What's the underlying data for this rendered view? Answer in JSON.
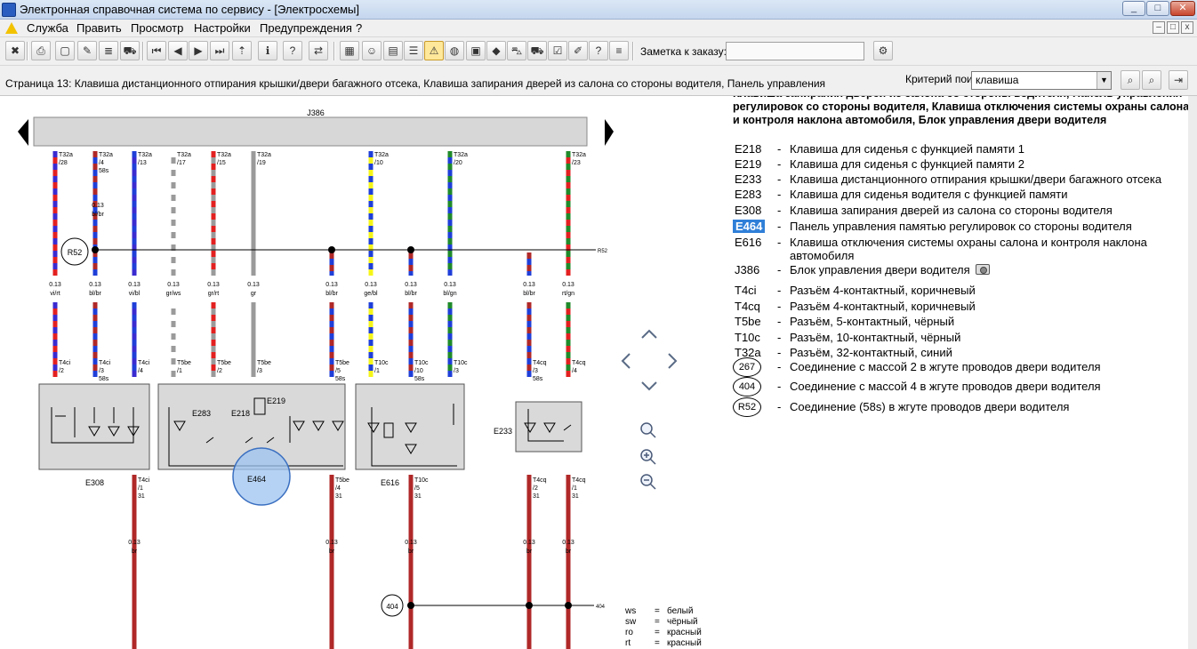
{
  "window": {
    "title": "Электронная справочная система по сервису - [Электросхемы]",
    "minimize_glyph": "_",
    "maximize_glyph": "□",
    "close_glyph": "✕"
  },
  "menu": {
    "items": [
      "Служба",
      "Править",
      "Просмотр",
      "Настройки",
      "Предупреждения",
      "?"
    ],
    "mdi_minimize": "–",
    "mdi_restore": "□",
    "mdi_close": "x"
  },
  "toolbar": {
    "order_label": "Заметка к заказу:",
    "order_value": ""
  },
  "status": {
    "page_caption": "Страница 13: Клавиша дистанционного отпирания крышки/двери багажного отсека, Клавиша запирания дверей из салона со стороны водителя, Панель управления",
    "criteria_label": "Критерий поиска:",
    "criteria_value": "клавиша"
  },
  "schematic": {
    "control_unit": "J386",
    "bus_label": "R52",
    "ground_label": "404",
    "top_pins": [
      {
        "conn": "T32a",
        "pin": "/28",
        "extra": "",
        "size": "0.13",
        "color": "vi/rt"
      },
      {
        "conn": "T32a",
        "pin": "/4",
        "extra": "58s",
        "size": "0.13",
        "color": "bl/br"
      },
      {
        "conn": "T32a",
        "pin": "/13",
        "extra": "",
        "size": "0.13",
        "color": "vi/bl"
      },
      {
        "conn": "T32a",
        "pin": "/17",
        "extra": "",
        "size": "0.13",
        "color": "gr/ws"
      },
      {
        "conn": "T32a",
        "pin": "/15",
        "extra": "",
        "size": "0.13",
        "color": "gr/rt"
      },
      {
        "conn": "T32a",
        "pin": "/19",
        "extra": "",
        "size": "0.13",
        "color": "gr"
      },
      {
        "conn": "",
        "pin": "",
        "extra": "",
        "size": "0.13",
        "color": "bl/br"
      },
      {
        "conn": "T32a",
        "pin": "/10",
        "extra": "",
        "size": "0.13",
        "color": "ge/bl"
      },
      {
        "conn": "",
        "pin": "",
        "extra": "",
        "size": "0.13",
        "color": "bl/br"
      },
      {
        "conn": "T32a",
        "pin": "/20",
        "extra": "",
        "size": "0.13",
        "color": "bl/gn"
      },
      {
        "conn": "",
        "pin": "",
        "extra": "",
        "size": "0.13",
        "color": "bl/br"
      },
      {
        "conn": "T32a",
        "pin": "/23",
        "extra": "",
        "size": "0.13",
        "color": "rt/gn"
      }
    ],
    "first_wire_size": "0.13",
    "first_wire_color": "bl/br",
    "mid_pins": [
      {
        "conn": "T4ci",
        "pin": "/2",
        "extra": ""
      },
      {
        "conn": "T4ci",
        "pin": "/3",
        "extra": "58s"
      },
      {
        "conn": "T4ci",
        "pin": "/4",
        "extra": ""
      },
      {
        "conn": "T5be",
        "pin": "/1",
        "extra": ""
      },
      {
        "conn": "T5be",
        "pin": "/2",
        "extra": ""
      },
      {
        "conn": "T5be",
        "pin": "/3",
        "extra": ""
      },
      {
        "conn": "T5be",
        "pin": "/5",
        "extra": "58s"
      },
      {
        "conn": "T10c",
        "pin": "/1",
        "extra": ""
      },
      {
        "conn": "T10c",
        "pin": "/10",
        "extra": "58s"
      },
      {
        "conn": "T10c",
        "pin": "/3",
        "extra": ""
      },
      {
        "conn": "T4cq",
        "pin": "/3",
        "extra": "58s"
      },
      {
        "conn": "T4cq",
        "pin": "/4",
        "extra": ""
      }
    ],
    "bottom_pins": [
      {
        "conn": "T4ci",
        "pin": "/1",
        "extra": "31"
      },
      {
        "conn": "T5be",
        "pin": "/4",
        "extra": "31"
      },
      {
        "conn": "T10c",
        "pin": "/5",
        "extra": "31"
      },
      {
        "conn": "T4cq",
        "pin": "/2",
        "extra": "31"
      },
      {
        "conn": "T4cq",
        "pin": "/1",
        "extra": "31"
      }
    ],
    "ground_wires": [
      {
        "size": "0.13",
        "color": "br"
      },
      {
        "size": "0.13",
        "color": "br"
      },
      {
        "size": "0.13",
        "color": "br"
      },
      {
        "size": "0.13",
        "color": "br"
      },
      {
        "size": "0.13",
        "color": "br"
      }
    ],
    "components": {
      "e308": "E308",
      "e283": "E283",
      "e218": "E218",
      "e219": "E219",
      "e464": "E464",
      "e616": "E616",
      "e233": "E233"
    },
    "color_key": [
      {
        "code": "ws",
        "eq": "=",
        "name": "белый"
      },
      {
        "code": "sw",
        "eq": "=",
        "name": "чёрный"
      },
      {
        "code": "ro",
        "eq": "=",
        "name": "красный"
      },
      {
        "code": "rt",
        "eq": "=",
        "name": "красный"
      }
    ],
    "colors": {
      "red": "#e32020",
      "blue": "#1f3fd8",
      "violet": "#3a2bd0",
      "grey": "#9a9a9a",
      "yellow": "#f5f51a",
      "green": "#1f8a2a",
      "brown": "#b02828",
      "highlight": "#9cc3f0"
    }
  },
  "legend": {
    "heading": "Клавиша запирания дверей из салона со стороны водителя, Панель управления регулировок со стороны водителя, Клавиша отключения системы охраны салона и контроля наклона автомобиля, Блок управления двери водителя",
    "dash": "-",
    "entries": [
      {
        "code": "E218",
        "desc": "Клавиша для сиденья с функцией памяти 1"
      },
      {
        "code": "E219",
        "desc": "Клавиша для сиденья с функцией памяти 2"
      },
      {
        "code": "E233",
        "desc": "Клавиша дистанционного отпирания крышки/двери багажного отсека"
      },
      {
        "code": "E283",
        "desc": "Клавиша для сиденья водителя с функцией памяти"
      },
      {
        "code": "E308",
        "desc": "Клавиша запирания дверей из салона со стороны водителя"
      },
      {
        "code": "E464",
        "desc": "Панель управления памятью регулировок со стороны водителя"
      },
      {
        "code": "E616",
        "desc": "Клавиша отключения системы охраны салона и контроля наклона автомобиля"
      },
      {
        "code": "J386",
        "desc": "Блок управления двери водителя"
      },
      {
        "code": "T4ci",
        "desc": "Разъём 4-контактный, коричневый"
      },
      {
        "code": "T4cq",
        "desc": "Разъём 4-контактный, коричневый"
      },
      {
        "code": "T5be",
        "desc": "Разъём, 5-контактный, чёрный"
      },
      {
        "code": "T10c",
        "desc": "Разъём, 10-контактный, чёрный"
      },
      {
        "code": "T32a",
        "desc": "Разъём, 32-контактный, синий"
      },
      {
        "code": "267",
        "desc": "Соединение с массой 2 в жгуте проводов двери водителя"
      },
      {
        "code": "404",
        "desc": "Соединение с массой 4 в жгуте проводов двери водителя"
      },
      {
        "code": "R52",
        "desc": "Соединение (58s) в жгуте проводов двери водителя"
      }
    ]
  },
  "icons": {
    "toolbar": [
      "exit-icon",
      "print-icon",
      "new-doc-icon",
      "edit-doc-icon",
      "notes-icon",
      "car-icon",
      "first-icon",
      "prev-icon",
      "next-icon",
      "last-icon",
      "up-icon",
      "info-icon",
      "help-icon",
      "swap-icon",
      "grid-icon",
      "person-icon",
      "book-icon",
      "list-icon",
      "warning-icon",
      "globe-icon",
      "calc-icon",
      "tag-icon",
      "car2-icon",
      "car3-icon",
      "check-icon",
      "edit-icon",
      "question-icon",
      "stack-icon",
      "settings-icon"
    ],
    "search_buttons": [
      "binoculars-icon",
      "binoculars-next-icon",
      "align-icon"
    ]
  }
}
